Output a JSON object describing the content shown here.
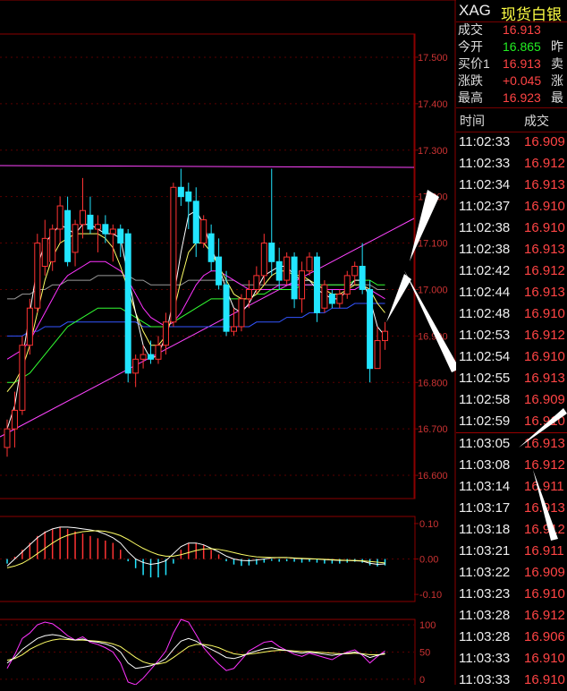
{
  "header": {
    "symbol": "XAG",
    "name": "现货白银"
  },
  "quote": [
    {
      "label": "成交",
      "value": "16.913",
      "color": "red",
      "label2": ""
    },
    {
      "label": "今开",
      "value": "16.865",
      "color": "green",
      "label2": "昨"
    },
    {
      "label": "买价1",
      "value": "16.913",
      "color": "red",
      "label2": "卖"
    },
    {
      "label": "涨跌",
      "value": "+0.045",
      "color": "red",
      "label2": "涨"
    },
    {
      "label": "最高",
      "value": "16.923",
      "color": "red",
      "label2": "最"
    }
  ],
  "ticks_header": {
    "time": "时间",
    "price": "成交"
  },
  "ticks": [
    {
      "time": "11:02:33",
      "price": "16.909",
      "color": "red"
    },
    {
      "time": "11:02:33",
      "price": "16.912",
      "color": "red"
    },
    {
      "time": "11:02:34",
      "price": "16.913",
      "color": "red"
    },
    {
      "time": "11:02:37",
      "price": "16.910",
      "color": "red"
    },
    {
      "time": "11:02:38",
      "price": "16.910",
      "color": "red"
    },
    {
      "time": "11:02:38",
      "price": "16.913",
      "color": "red"
    },
    {
      "time": "11:02:42",
      "price": "16.912",
      "color": "red"
    },
    {
      "time": "11:02:44",
      "price": "16.913",
      "color": "red"
    },
    {
      "time": "11:02:48",
      "price": "16.910",
      "color": "red"
    },
    {
      "time": "11:02:53",
      "price": "16.912",
      "color": "red"
    },
    {
      "time": "11:02:54",
      "price": "16.910",
      "color": "red"
    },
    {
      "time": "11:02:55",
      "price": "16.913",
      "color": "red"
    },
    {
      "time": "11:02:58",
      "price": "16.909",
      "color": "red"
    },
    {
      "time": "11:02:59",
      "price": "16.910",
      "color": "red"
    },
    {
      "time": "11:03:05",
      "price": "16.913",
      "color": "red"
    },
    {
      "time": "11:03:08",
      "price": "16.912",
      "color": "red"
    },
    {
      "time": "11:03:14",
      "price": "16.911",
      "color": "red"
    },
    {
      "time": "11:03:17",
      "price": "16.913",
      "color": "red"
    },
    {
      "time": "11:03:18",
      "price": "16.912",
      "color": "red"
    },
    {
      "time": "11:03:21",
      "price": "16.911",
      "color": "red"
    },
    {
      "time": "11:03:22",
      "price": "16.909",
      "color": "red"
    },
    {
      "time": "11:03:23",
      "price": "16.910",
      "color": "red"
    },
    {
      "time": "11:03:28",
      "price": "16.912",
      "color": "red"
    },
    {
      "time": "11:03:28",
      "price": "16.906",
      "color": "red"
    },
    {
      "time": "11:03:33",
      "price": "16.910",
      "color": "red"
    },
    {
      "time": "11:03:33",
      "price": "16.910",
      "color": "red"
    }
  ],
  "main_axis": [
    "17.500",
    "17.400",
    "17.300",
    "17.200",
    "17.100",
    "17.000",
    "16.900",
    "16.800",
    "16.700",
    "16.600"
  ],
  "macd_axis": [
    "0.10",
    "0.00",
    "-0.10"
  ],
  "kdj_axis": [
    "100",
    "50",
    "0"
  ],
  "colors": {
    "up": "#ff3333",
    "down": "#22e5ff",
    "grid": "#8b0000",
    "white": "#ffffff",
    "magenta": "#ff33ff",
    "yellow": "#ffff66"
  },
  "chart_data": {
    "type": "candlestick",
    "ylim": [
      16.55,
      17.55
    ],
    "candles": [
      {
        "o": 16.66,
        "h": 16.72,
        "l": 16.64,
        "c": 16.7
      },
      {
        "o": 16.7,
        "h": 16.78,
        "l": 16.66,
        "c": 16.74
      },
      {
        "o": 16.74,
        "h": 16.9,
        "l": 16.73,
        "c": 16.88
      },
      {
        "o": 16.88,
        "h": 16.98,
        "l": 16.86,
        "c": 16.96
      },
      {
        "o": 16.96,
        "h": 17.12,
        "l": 16.95,
        "c": 17.1
      },
      {
        "o": 17.05,
        "h": 17.15,
        "l": 17.03,
        "c": 17.11
      },
      {
        "o": 17.06,
        "h": 17.14,
        "l": 17.04,
        "c": 17.13
      },
      {
        "o": 17.13,
        "h": 17.2,
        "l": 17.1,
        "c": 17.18
      },
      {
        "o": 17.17,
        "h": 17.2,
        "l": 17.05,
        "c": 17.06
      },
      {
        "o": 17.08,
        "h": 17.15,
        "l": 17.05,
        "c": 17.14
      },
      {
        "o": 17.14,
        "h": 17.24,
        "l": 17.11,
        "c": 17.17
      },
      {
        "o": 17.16,
        "h": 17.2,
        "l": 17.12,
        "c": 17.13
      },
      {
        "o": 17.13,
        "h": 17.16,
        "l": 17.08,
        "c": 17.14
      },
      {
        "o": 17.14,
        "h": 17.16,
        "l": 17.1,
        "c": 17.12
      },
      {
        "o": 17.12,
        "h": 17.14,
        "l": 17.06,
        "c": 17.13
      },
      {
        "o": 17.13,
        "h": 17.14,
        "l": 17.07,
        "c": 17.1
      },
      {
        "o": 17.12,
        "h": 17.13,
        "l": 16.8,
        "c": 16.82
      },
      {
        "o": 16.82,
        "h": 16.86,
        "l": 16.79,
        "c": 16.85
      },
      {
        "o": 16.85,
        "h": 16.88,
        "l": 16.83,
        "c": 16.86
      },
      {
        "o": 16.86,
        "h": 16.89,
        "l": 16.84,
        "c": 16.85
      },
      {
        "o": 16.85,
        "h": 16.9,
        "l": 16.84,
        "c": 16.88
      },
      {
        "o": 16.88,
        "h": 16.95,
        "l": 16.86,
        "c": 16.93
      },
      {
        "o": 16.93,
        "h": 17.23,
        "l": 16.92,
        "c": 17.22
      },
      {
        "o": 17.22,
        "h": 17.26,
        "l": 17.18,
        "c": 17.2
      },
      {
        "o": 17.21,
        "h": 17.23,
        "l": 17.13,
        "c": 17.19
      },
      {
        "o": 17.19,
        "h": 17.22,
        "l": 17.07,
        "c": 17.1
      },
      {
        "o": 17.1,
        "h": 17.16,
        "l": 17.09,
        "c": 17.15
      },
      {
        "o": 17.12,
        "h": 17.14,
        "l": 17.04,
        "c": 17.06
      },
      {
        "o": 17.07,
        "h": 17.11,
        "l": 17.0,
        "c": 17.01
      },
      {
        "o": 17.01,
        "h": 17.04,
        "l": 16.9,
        "c": 16.91
      },
      {
        "o": 16.91,
        "h": 16.96,
        "l": 16.9,
        "c": 16.92
      },
      {
        "o": 16.92,
        "h": 16.99,
        "l": 16.91,
        "c": 16.98
      },
      {
        "o": 16.98,
        "h": 17.02,
        "l": 16.96,
        "c": 17.0
      },
      {
        "o": 17.0,
        "h": 17.05,
        "l": 16.99,
        "c": 17.03
      },
      {
        "o": 17.03,
        "h": 17.12,
        "l": 17.01,
        "c": 17.1
      },
      {
        "o": 17.1,
        "h": 17.26,
        "l": 17.03,
        "c": 17.06
      },
      {
        "o": 17.06,
        "h": 17.09,
        "l": 17.0,
        "c": 17.02
      },
      {
        "o": 17.02,
        "h": 17.08,
        "l": 17.01,
        "c": 17.07
      },
      {
        "o": 17.07,
        "h": 17.08,
        "l": 16.96,
        "c": 16.98
      },
      {
        "o": 16.98,
        "h": 17.06,
        "l": 16.95,
        "c": 17.04
      },
      {
        "o": 17.04,
        "h": 17.08,
        "l": 17.03,
        "c": 17.07
      },
      {
        "o": 17.07,
        "h": 17.08,
        "l": 16.93,
        "c": 16.95
      },
      {
        "o": 16.96,
        "h": 17.02,
        "l": 16.95,
        "c": 17.01
      },
      {
        "o": 16.99,
        "h": 17.0,
        "l": 16.96,
        "c": 16.97
      },
      {
        "o": 16.97,
        "h": 17.0,
        "l": 16.96,
        "c": 16.99
      },
      {
        "o": 16.99,
        "h": 17.04,
        "l": 16.98,
        "c": 17.03
      },
      {
        "o": 17.03,
        "h": 17.06,
        "l": 17.01,
        "c": 17.05
      },
      {
        "o": 17.05,
        "h": 17.1,
        "l": 16.99,
        "c": 17.0
      },
      {
        "o": 17.0,
        "h": 17.02,
        "l": 16.8,
        "c": 16.83
      },
      {
        "o": 16.83,
        "h": 16.92,
        "l": 16.83,
        "c": 16.89
      },
      {
        "o": 16.89,
        "h": 16.93,
        "l": 16.87,
        "c": 16.91
      }
    ],
    "ma_white": [
      16.7,
      16.75,
      16.85,
      16.95,
      17.05,
      17.1,
      17.12,
      17.14,
      17.13,
      17.12,
      17.14,
      17.14,
      17.13,
      17.12,
      17.12,
      17.11,
      17.03,
      16.95,
      16.88,
      16.85,
      16.86,
      16.9,
      16.98,
      17.08,
      17.16,
      17.17,
      17.14,
      17.09,
      17.05,
      17.0,
      16.96,
      16.95,
      16.97,
      17.0,
      17.03,
      17.04,
      17.05,
      17.05,
      17.03,
      17.02,
      17.02,
      17.0,
      16.99,
      16.98,
      16.98,
      17.0,
      17.02,
      17.02,
      16.98,
      16.92,
      16.9
    ],
    "ma_yellow": [
      16.78,
      16.8,
      16.83,
      16.88,
      16.95,
      17.02,
      17.07,
      17.1,
      17.11,
      17.12,
      17.12,
      17.12,
      17.12,
      17.11,
      17.09,
      17.05,
      17.0,
      16.95,
      16.91,
      16.88,
      16.88,
      16.9,
      16.95,
      17.02,
      17.08,
      17.1,
      17.1,
      17.08,
      17.05,
      17.02,
      16.99,
      16.98,
      16.98,
      16.99,
      17.01,
      17.03,
      17.04,
      17.04,
      17.03,
      17.03,
      17.02,
      17.01,
      17.0,
      16.99,
      16.99,
      17.0,
      17.01,
      17.01,
      17.0,
      16.97,
      16.95
    ],
    "ma_magenta": [
      16.85,
      16.86,
      16.87,
      16.89,
      16.92,
      16.95,
      16.98,
      17.01,
      17.03,
      17.04,
      17.05,
      17.06,
      17.06,
      17.06,
      17.05,
      17.04,
      17.02,
      16.99,
      16.96,
      16.94,
      16.93,
      16.92,
      16.93,
      16.95,
      16.98,
      17.01,
      17.03,
      17.04,
      17.04,
      17.03,
      17.02,
      17.01,
      17.0,
      17.0,
      17.0,
      17.0,
      17.01,
      17.01,
      17.01,
      17.01,
      17.01,
      17.01,
      17.0,
      17.0,
      17.0,
      17.0,
      17.0,
      17.01,
      17.0,
      16.99,
      16.98
    ],
    "ma_green": [
      16.8,
      16.8,
      16.81,
      16.82,
      16.84,
      16.86,
      16.88,
      16.9,
      16.92,
      16.93,
      16.94,
      16.95,
      16.96,
      16.96,
      16.96,
      16.96,
      16.95,
      16.94,
      16.93,
      16.92,
      16.92,
      16.92,
      16.93,
      16.94,
      16.95,
      16.96,
      16.97,
      16.98,
      16.98,
      16.98,
      16.98,
      16.98,
      16.98,
      16.99,
      16.99,
      17.0,
      17.0,
      17.0,
      17.0,
      17.01,
      17.01,
      17.01,
      17.01,
      17.01,
      17.01,
      17.01,
      17.02,
      17.02,
      17.02,
      17.01,
      17.01
    ],
    "ma_gray": [
      16.98,
      16.98,
      16.99,
      16.99,
      17.0,
      17.0,
      17.01,
      17.01,
      17.02,
      17.02,
      17.02,
      17.02,
      17.03,
      17.03,
      17.03,
      17.03,
      17.03,
      17.02,
      17.02,
      17.01,
      17.01,
      17.01,
      17.01,
      17.01,
      17.02,
      17.02,
      17.02,
      17.02,
      17.02,
      17.02,
      17.02,
      17.01,
      17.01,
      17.01,
      17.01,
      17.01,
      17.01,
      17.01,
      17.01,
      17.01,
      17.01,
      17.01,
      17.01,
      17.01,
      17.01,
      17.01,
      17.01,
      17.01,
      17.01,
      17.0,
      17.0
    ],
    "ma_blue": [
      16.9,
      16.9,
      16.9,
      16.91,
      16.91,
      16.92,
      16.92,
      16.92,
      16.93,
      16.93,
      16.93,
      16.93,
      16.93,
      16.93,
      16.93,
      16.93,
      16.93,
      16.93,
      16.92,
      16.92,
      16.92,
      16.92,
      16.92,
      16.92,
      16.92,
      16.92,
      16.92,
      16.92,
      16.92,
      16.92,
      16.92,
      16.92,
      16.92,
      16.93,
      16.93,
      16.93,
      16.93,
      16.94,
      16.94,
      16.94,
      16.95,
      16.95,
      16.95,
      16.96,
      16.96,
      16.96,
      16.97,
      16.97,
      16.97,
      16.97,
      16.97
    ],
    "macd_ylim": [
      -0.12,
      0.12
    ],
    "macd_hist": [
      -0.01,
      0.005,
      0.02,
      0.035,
      0.05,
      0.06,
      0.065,
      0.07,
      0.065,
      0.06,
      0.055,
      0.05,
      0.045,
      0.04,
      0.035,
      0.02,
      -0.005,
      -0.02,
      -0.035,
      -0.04,
      -0.04,
      -0.035,
      -0.01,
      0.02,
      0.035,
      0.035,
      0.03,
      0.02,
      0.01,
      -0.005,
      -0.012,
      -0.015,
      -0.014,
      -0.012,
      -0.008,
      -0.004,
      -0.006,
      -0.005,
      -0.006,
      -0.008,
      -0.006,
      -0.008,
      -0.01,
      -0.01,
      -0.01,
      -0.008,
      -0.006,
      -0.008,
      -0.014,
      -0.016,
      -0.014
    ],
    "macd_dif": [
      -0.02,
      0.0,
      0.02,
      0.04,
      0.06,
      0.075,
      0.085,
      0.09,
      0.09,
      0.088,
      0.085,
      0.082,
      0.078,
      0.07,
      0.06,
      0.045,
      0.02,
      0.0,
      -0.01,
      -0.015,
      -0.012,
      -0.005,
      0.015,
      0.035,
      0.045,
      0.045,
      0.04,
      0.03,
      0.02,
      0.008,
      0.0,
      -0.004,
      -0.005,
      -0.003,
      0.0,
      0.003,
      0.004,
      0.004,
      0.002,
      0.001,
      0.0,
      0.0,
      -0.002,
      -0.003,
      -0.004,
      -0.004,
      -0.005,
      -0.006,
      -0.012,
      -0.015,
      -0.014
    ],
    "macd_dea": [
      -0.025,
      -0.02,
      -0.012,
      0.0,
      0.015,
      0.03,
      0.045,
      0.058,
      0.067,
      0.073,
      0.077,
      0.079,
      0.08,
      0.078,
      0.073,
      0.066,
      0.055,
      0.042,
      0.03,
      0.02,
      0.012,
      0.008,
      0.008,
      0.012,
      0.018,
      0.024,
      0.028,
      0.029,
      0.027,
      0.023,
      0.018,
      0.013,
      0.009,
      0.006,
      0.005,
      0.004,
      0.004,
      0.004,
      0.003,
      0.002,
      0.001,
      0.0,
      -0.001,
      -0.002,
      -0.003,
      -0.004,
      -0.004,
      -0.005,
      -0.007,
      -0.009,
      -0.011
    ],
    "kdj_ylim": [
      -10,
      110
    ],
    "kdj_k": [
      30,
      40,
      55,
      65,
      75,
      80,
      82,
      80,
      75,
      72,
      74,
      70,
      68,
      65,
      60,
      50,
      30,
      20,
      22,
      25,
      30,
      38,
      55,
      70,
      75,
      70,
      62,
      55,
      48,
      40,
      38,
      42,
      48,
      52,
      56,
      58,
      55,
      53,
      50,
      48,
      50,
      48,
      46,
      44,
      46,
      48,
      50,
      46,
      40,
      44,
      48
    ],
    "kdj_d": [
      35,
      38,
      45,
      55,
      62,
      68,
      72,
      74,
      73,
      72,
      72,
      71,
      70,
      68,
      65,
      60,
      50,
      40,
      32,
      28,
      28,
      31,
      40,
      50,
      60,
      64,
      64,
      62,
      58,
      52,
      47,
      45,
      46,
      48,
      50,
      52,
      53,
      53,
      52,
      51,
      51,
      50,
      49,
      48,
      47,
      47,
      48,
      47,
      45,
      45,
      46
    ],
    "kdj_j": [
      20,
      45,
      75,
      85,
      100,
      105,
      102,
      92,
      80,
      72,
      78,
      68,
      64,
      58,
      50,
      30,
      -5,
      -10,
      2,
      18,
      34,
      52,
      85,
      110,
      105,
      82,
      58,
      42,
      28,
      16,
      20,
      36,
      52,
      60,
      68,
      70,
      60,
      53,
      46,
      42,
      48,
      44,
      40,
      36,
      44,
      50,
      54,
      44,
      30,
      42,
      52
    ]
  }
}
